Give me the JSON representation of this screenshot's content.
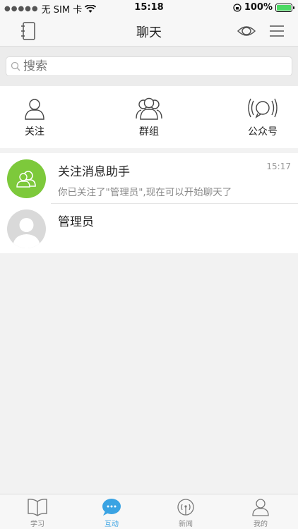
{
  "status_bar": {
    "carrier": "无 SIM 卡",
    "time": "15:18",
    "battery": "100%",
    "battery_level": 1.0
  },
  "header": {
    "title": "聊天",
    "left_icon": "contacts-book-icon",
    "right_icons": [
      "eye-icon",
      "menu-icon"
    ]
  },
  "search": {
    "placeholder": "搜索"
  },
  "quick_actions": [
    {
      "label": "关注",
      "icon": "person-icon"
    },
    {
      "label": "群组",
      "icon": "group-icon"
    },
    {
      "label": "公众号",
      "icon": "broadcast-icon"
    }
  ],
  "chats": [
    {
      "name": "关注消息助手",
      "preview": "你已关注了\"管理员\",现在可以开始聊天了",
      "time": "15:17",
      "avatar_color": "#7dc93b"
    },
    {
      "name": "管理员",
      "preview": "",
      "time": "",
      "avatar_color": "#d9d9d9"
    }
  ],
  "tabs": [
    {
      "label": "学习",
      "icon": "book-icon",
      "active": false
    },
    {
      "label": "互动",
      "icon": "chat-bubble-icon",
      "active": true
    },
    {
      "label": "新闻",
      "icon": "antenna-icon",
      "active": false
    },
    {
      "label": "我的",
      "icon": "profile-icon",
      "active": false
    }
  ],
  "colors": {
    "accent": "#3aa3e3",
    "assistant_avatar": "#7dc93b"
  }
}
